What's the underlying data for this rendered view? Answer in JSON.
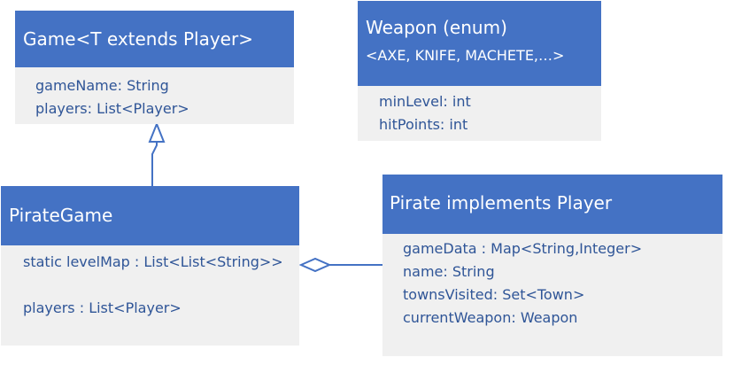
{
  "colors": {
    "header": "#4472c4",
    "body": "#f0f0f0",
    "text": "#2f5597",
    "line": "#4472c4"
  },
  "game": {
    "title": "Game<T extends Player>",
    "attributes": [
      "gameName: String",
      "players: List<Player>"
    ]
  },
  "weapon": {
    "title": "Weapon (enum)",
    "subtitle": "<AXE, KNIFE, MACHETE,…>",
    "attributes": [
      "minLevel:  int",
      "hitPoints:  int"
    ]
  },
  "pirate_game": {
    "title": "PirateGame",
    "attributes": [
      "static levelMap : List<List<String>>",
      "players : List<Player>"
    ]
  },
  "pirate": {
    "title": "Pirate implements Player",
    "attributes": [
      "gameData :  Map<String,Integer>",
      "name: String",
      "townsVisited:  Set<Town>",
      "currentWeapon: Weapon"
    ]
  }
}
